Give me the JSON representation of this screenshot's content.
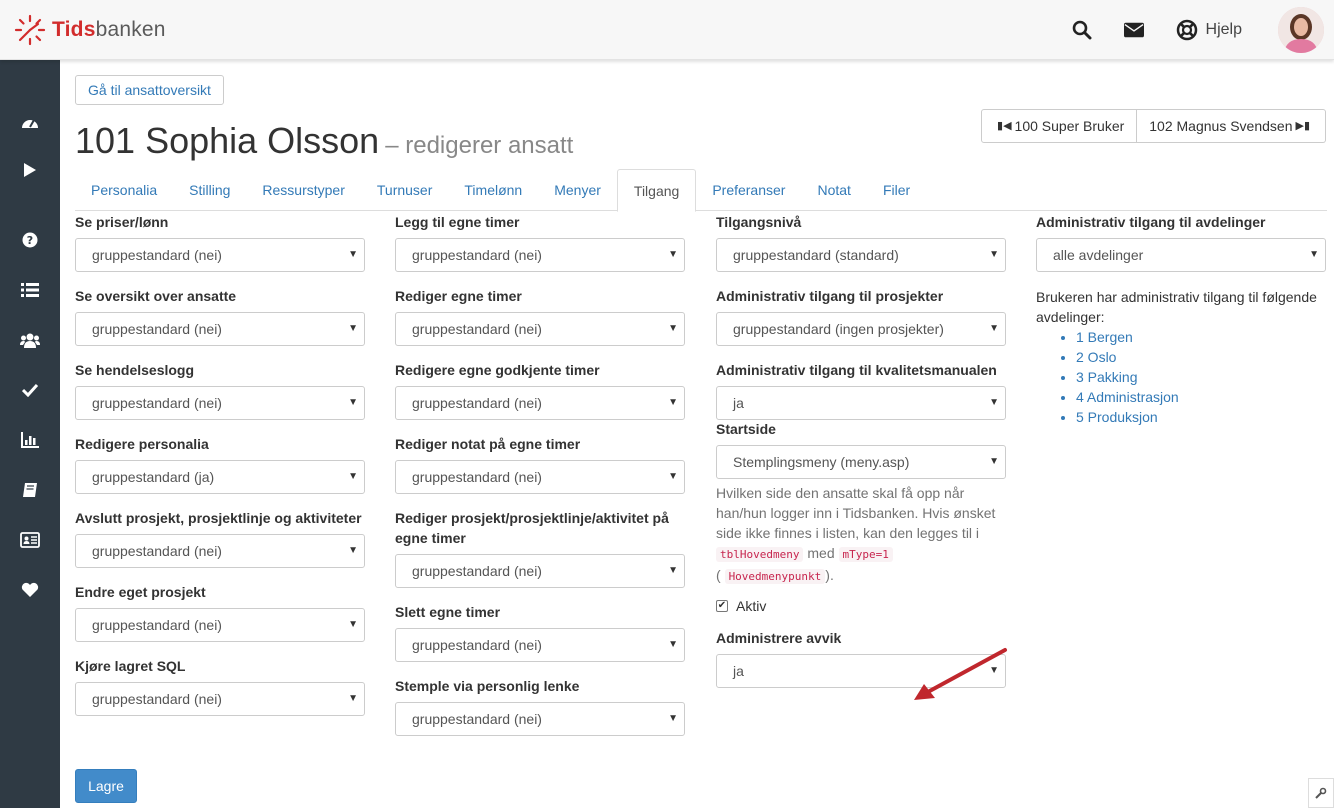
{
  "brand": {
    "name_part1": "Tids",
    "name_part2": "banken"
  },
  "header": {
    "help_label": "Hjelp",
    "icons": [
      "search-icon",
      "mail-icon",
      "lifebuoy-icon"
    ]
  },
  "sidebar": {
    "icons": [
      "dashboard-icon",
      "play-icon",
      "question-icon",
      "list-icon",
      "users-icon",
      "check-icon",
      "bar-chart-icon",
      "book-icon",
      "id-card-icon",
      "heart-icon"
    ]
  },
  "main": {
    "back_button": "Gå til ansattoversikt",
    "title": "101 Sophia Olsson",
    "subtitle": "– redigerer ansatt",
    "prev_employee": "100 Super Bruker",
    "next_employee": "102 Magnus Svendsen",
    "tabs": [
      "Personalia",
      "Stilling",
      "Ressurstyper",
      "Turnuser",
      "Timelønn",
      "Menyer",
      "Tilgang",
      "Preferanser",
      "Notat",
      "Filer"
    ],
    "active_tab": "Tilgang",
    "col1": [
      {
        "label": "Se priser/lønn",
        "value": "gruppestandard (nei)"
      },
      {
        "label": "Se oversikt over ansatte",
        "value": "gruppestandard (nei)"
      },
      {
        "label": "Se hendelseslogg",
        "value": "gruppestandard (nei)"
      },
      {
        "label": "Redigere personalia",
        "value": "gruppestandard (ja)"
      },
      {
        "label": "Avslutt prosjekt, prosjektlinje og aktiviteter",
        "value": "gruppestandard (nei)"
      },
      {
        "label": "Endre eget prosjekt",
        "value": "gruppestandard (nei)"
      },
      {
        "label": "Kjøre lagret SQL",
        "value": "gruppestandard (nei)"
      }
    ],
    "col2": [
      {
        "label": "Legg til egne timer",
        "value": "gruppestandard (nei)"
      },
      {
        "label": "Rediger egne timer",
        "value": "gruppestandard (nei)"
      },
      {
        "label": "Redigere egne godkjente timer",
        "value": "gruppestandard (nei)"
      },
      {
        "label": "Rediger notat på egne timer",
        "value": "gruppestandard (nei)"
      },
      {
        "label": "Rediger prosjekt/prosjektlinje/aktivitet på egne timer",
        "value": "gruppestandard (nei)"
      },
      {
        "label": "Slett egne timer",
        "value": "gruppestandard (nei)"
      },
      {
        "label": "Stemple via personlig lenke",
        "value": "gruppestandard (nei)"
      }
    ],
    "col3": {
      "access_level": {
        "label": "Tilgangsnivå",
        "value": "gruppestandard (standard)"
      },
      "admin_projects": {
        "label": "Administrativ tilgang til prosjekter",
        "value": "gruppestandard (ingen prosjekter)"
      },
      "admin_quality": {
        "label": "Administrativ tilgang til kvalitetsmanualen",
        "value": "ja"
      },
      "start_page": {
        "label": "Startside",
        "value": "Stemplingsmeny (meny.asp)"
      },
      "help_text": "Hvilken side den ansatte skal få opp når han/hun logger inn i Tidsbanken. Hvis ønsket side ikke finnes i listen, kan den legges til i",
      "code1": "tblHovedmeny",
      "help_mid": "med",
      "code2": "mType=1",
      "paren_open": "(",
      "code3": "Hovedmenypunkt",
      "paren_close": ").",
      "active_label": "Aktiv",
      "deviations": {
        "label": "Administrere avvik",
        "value": "ja"
      }
    },
    "col4": {
      "label": "Administrativ tilgang til avdelinger",
      "value": "alle avdelinger",
      "info": "Brukeren har administrativ tilgang til følgende avdelinger:",
      "departments": [
        "1 Bergen",
        "2 Oslo",
        "3 Pakking",
        "4 Administrasjon",
        "5 Produksjon"
      ]
    },
    "save_button": "Lagre"
  },
  "colors": {
    "sidebar": "#2f3a44",
    "link": "#337ab7",
    "primary": "#428bca",
    "brand_red": "#d22c2c",
    "arrow": "#c0272d"
  }
}
